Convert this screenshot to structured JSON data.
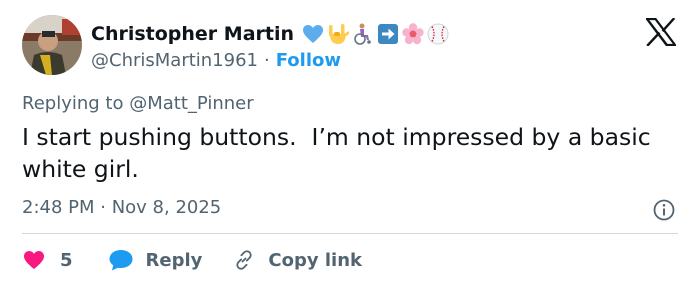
{
  "author": {
    "name": "Christopher Martin",
    "handle": "@ChrisMartin1961",
    "separator": "·",
    "follow_label": "Follow",
    "emojis": [
      "blue-heart-icon",
      "love-you-gesture-icon",
      "wheelchair-person-icon",
      "right-arrow-icon",
      "cherry-blossom-icon",
      "baseball-icon"
    ]
  },
  "reply_to": {
    "prefix": "Replying to ",
    "mention": "@Matt_Pinner"
  },
  "tweet": {
    "text": "I start pushing buttons.  I’m not impressed by a basic white girl.",
    "timestamp": "2:48 PM · Nov 8, 2025"
  },
  "actions": {
    "like_count": "5",
    "reply_label": "Reply",
    "copy_label": "Copy link"
  },
  "colors": {
    "text": "#0f1419",
    "secondary": "#536471",
    "accent": "#1d9bf0",
    "like": "#f91880",
    "divider": "#cfd9de"
  }
}
